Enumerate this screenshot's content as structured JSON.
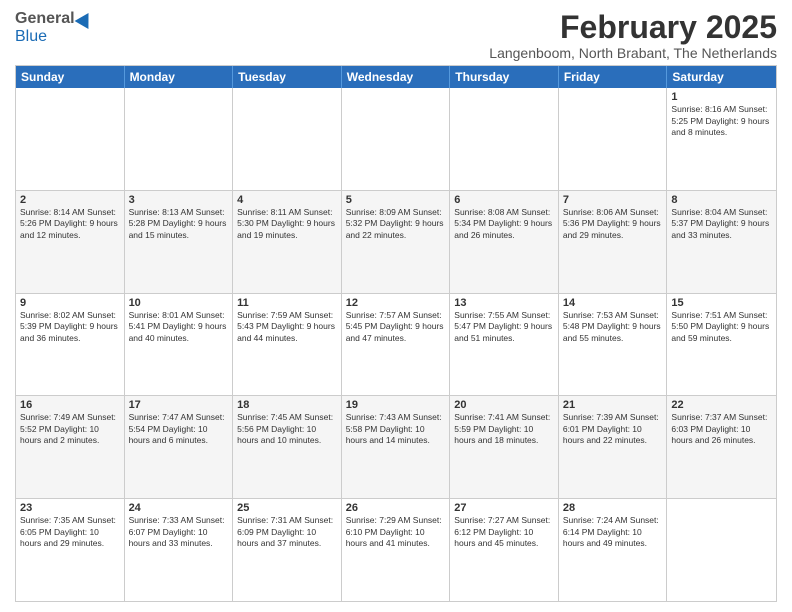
{
  "logo": {
    "general": "General",
    "blue": "Blue"
  },
  "header": {
    "month": "February 2025",
    "location": "Langenboom, North Brabant, The Netherlands"
  },
  "weekdays": [
    "Sunday",
    "Monday",
    "Tuesday",
    "Wednesday",
    "Thursday",
    "Friday",
    "Saturday"
  ],
  "weeks": [
    [
      {
        "day": "",
        "info": ""
      },
      {
        "day": "",
        "info": ""
      },
      {
        "day": "",
        "info": ""
      },
      {
        "day": "",
        "info": ""
      },
      {
        "day": "",
        "info": ""
      },
      {
        "day": "",
        "info": ""
      },
      {
        "day": "1",
        "info": "Sunrise: 8:16 AM\nSunset: 5:25 PM\nDaylight: 9 hours and 8 minutes."
      }
    ],
    [
      {
        "day": "2",
        "info": "Sunrise: 8:14 AM\nSunset: 5:26 PM\nDaylight: 9 hours and 12 minutes."
      },
      {
        "day": "3",
        "info": "Sunrise: 8:13 AM\nSunset: 5:28 PM\nDaylight: 9 hours and 15 minutes."
      },
      {
        "day": "4",
        "info": "Sunrise: 8:11 AM\nSunset: 5:30 PM\nDaylight: 9 hours and 19 minutes."
      },
      {
        "day": "5",
        "info": "Sunrise: 8:09 AM\nSunset: 5:32 PM\nDaylight: 9 hours and 22 minutes."
      },
      {
        "day": "6",
        "info": "Sunrise: 8:08 AM\nSunset: 5:34 PM\nDaylight: 9 hours and 26 minutes."
      },
      {
        "day": "7",
        "info": "Sunrise: 8:06 AM\nSunset: 5:36 PM\nDaylight: 9 hours and 29 minutes."
      },
      {
        "day": "8",
        "info": "Sunrise: 8:04 AM\nSunset: 5:37 PM\nDaylight: 9 hours and 33 minutes."
      }
    ],
    [
      {
        "day": "9",
        "info": "Sunrise: 8:02 AM\nSunset: 5:39 PM\nDaylight: 9 hours and 36 minutes."
      },
      {
        "day": "10",
        "info": "Sunrise: 8:01 AM\nSunset: 5:41 PM\nDaylight: 9 hours and 40 minutes."
      },
      {
        "day": "11",
        "info": "Sunrise: 7:59 AM\nSunset: 5:43 PM\nDaylight: 9 hours and 44 minutes."
      },
      {
        "day": "12",
        "info": "Sunrise: 7:57 AM\nSunset: 5:45 PM\nDaylight: 9 hours and 47 minutes."
      },
      {
        "day": "13",
        "info": "Sunrise: 7:55 AM\nSunset: 5:47 PM\nDaylight: 9 hours and 51 minutes."
      },
      {
        "day": "14",
        "info": "Sunrise: 7:53 AM\nSunset: 5:48 PM\nDaylight: 9 hours and 55 minutes."
      },
      {
        "day": "15",
        "info": "Sunrise: 7:51 AM\nSunset: 5:50 PM\nDaylight: 9 hours and 59 minutes."
      }
    ],
    [
      {
        "day": "16",
        "info": "Sunrise: 7:49 AM\nSunset: 5:52 PM\nDaylight: 10 hours and 2 minutes."
      },
      {
        "day": "17",
        "info": "Sunrise: 7:47 AM\nSunset: 5:54 PM\nDaylight: 10 hours and 6 minutes."
      },
      {
        "day": "18",
        "info": "Sunrise: 7:45 AM\nSunset: 5:56 PM\nDaylight: 10 hours and 10 minutes."
      },
      {
        "day": "19",
        "info": "Sunrise: 7:43 AM\nSunset: 5:58 PM\nDaylight: 10 hours and 14 minutes."
      },
      {
        "day": "20",
        "info": "Sunrise: 7:41 AM\nSunset: 5:59 PM\nDaylight: 10 hours and 18 minutes."
      },
      {
        "day": "21",
        "info": "Sunrise: 7:39 AM\nSunset: 6:01 PM\nDaylight: 10 hours and 22 minutes."
      },
      {
        "day": "22",
        "info": "Sunrise: 7:37 AM\nSunset: 6:03 PM\nDaylight: 10 hours and 26 minutes."
      }
    ],
    [
      {
        "day": "23",
        "info": "Sunrise: 7:35 AM\nSunset: 6:05 PM\nDaylight: 10 hours and 29 minutes."
      },
      {
        "day": "24",
        "info": "Sunrise: 7:33 AM\nSunset: 6:07 PM\nDaylight: 10 hours and 33 minutes."
      },
      {
        "day": "25",
        "info": "Sunrise: 7:31 AM\nSunset: 6:09 PM\nDaylight: 10 hours and 37 minutes."
      },
      {
        "day": "26",
        "info": "Sunrise: 7:29 AM\nSunset: 6:10 PM\nDaylight: 10 hours and 41 minutes."
      },
      {
        "day": "27",
        "info": "Sunrise: 7:27 AM\nSunset: 6:12 PM\nDaylight: 10 hours and 45 minutes."
      },
      {
        "day": "28",
        "info": "Sunrise: 7:24 AM\nSunset: 6:14 PM\nDaylight: 10 hours and 49 minutes."
      },
      {
        "day": "",
        "info": ""
      }
    ]
  ]
}
